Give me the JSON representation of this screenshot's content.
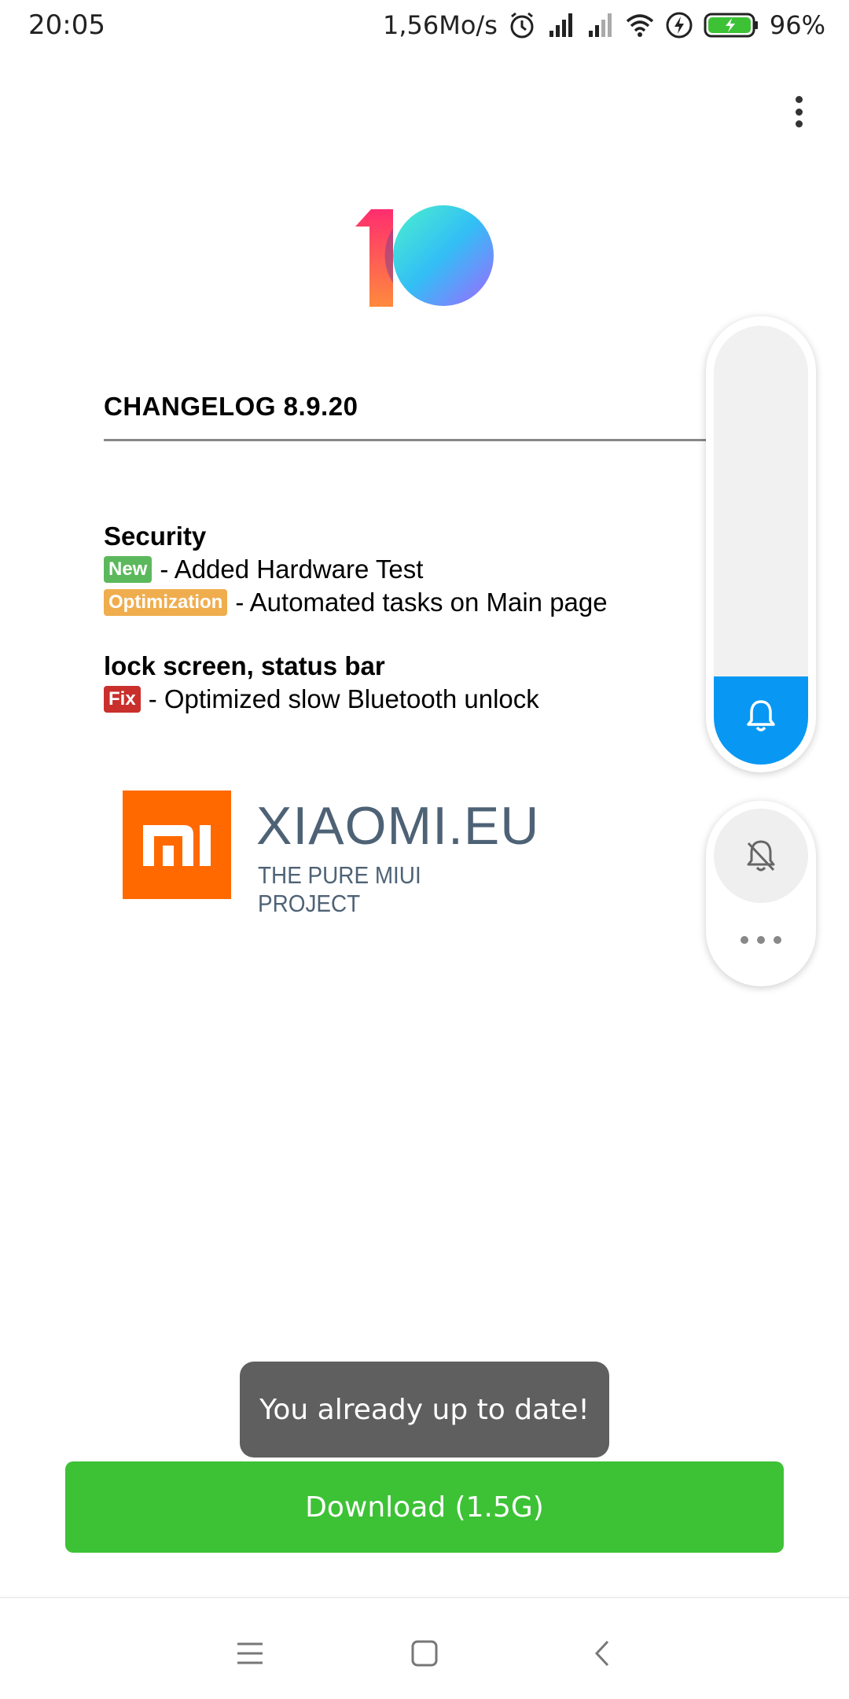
{
  "status_bar": {
    "time": "20:05",
    "net_speed": "1,56Mo/s",
    "battery": "96%",
    "icons": [
      "alarm-icon",
      "signal-icon",
      "signal-icon",
      "wifi-icon",
      "charging-icon",
      "battery-icon"
    ]
  },
  "changelog": {
    "title": "CHANGELOG 8.9.20",
    "sections": [
      {
        "title": "Security",
        "entries": [
          {
            "badge": "New",
            "text": "- Added Hardware Test"
          },
          {
            "badge": "Optimization",
            "text": "- Automated tasks on Main page"
          }
        ]
      },
      {
        "title": "lock screen, status bar",
        "entries": [
          {
            "badge": "Fix",
            "text": "- Optimized slow Bluetooth unlock"
          }
        ]
      }
    ]
  },
  "brand": {
    "name": "XIAOMI.EU",
    "tagline": "THE PURE MIUI PROJECT",
    "logo_text": "mi",
    "color": "#ff6900"
  },
  "volume": {
    "level": 0.2,
    "accent": "#0898f4"
  },
  "toast": "You already up to date!",
  "download": {
    "label": "Download (1.5G)",
    "color": "#3dc236"
  },
  "nav": [
    "menu-icon",
    "home-icon",
    "back-icon"
  ]
}
